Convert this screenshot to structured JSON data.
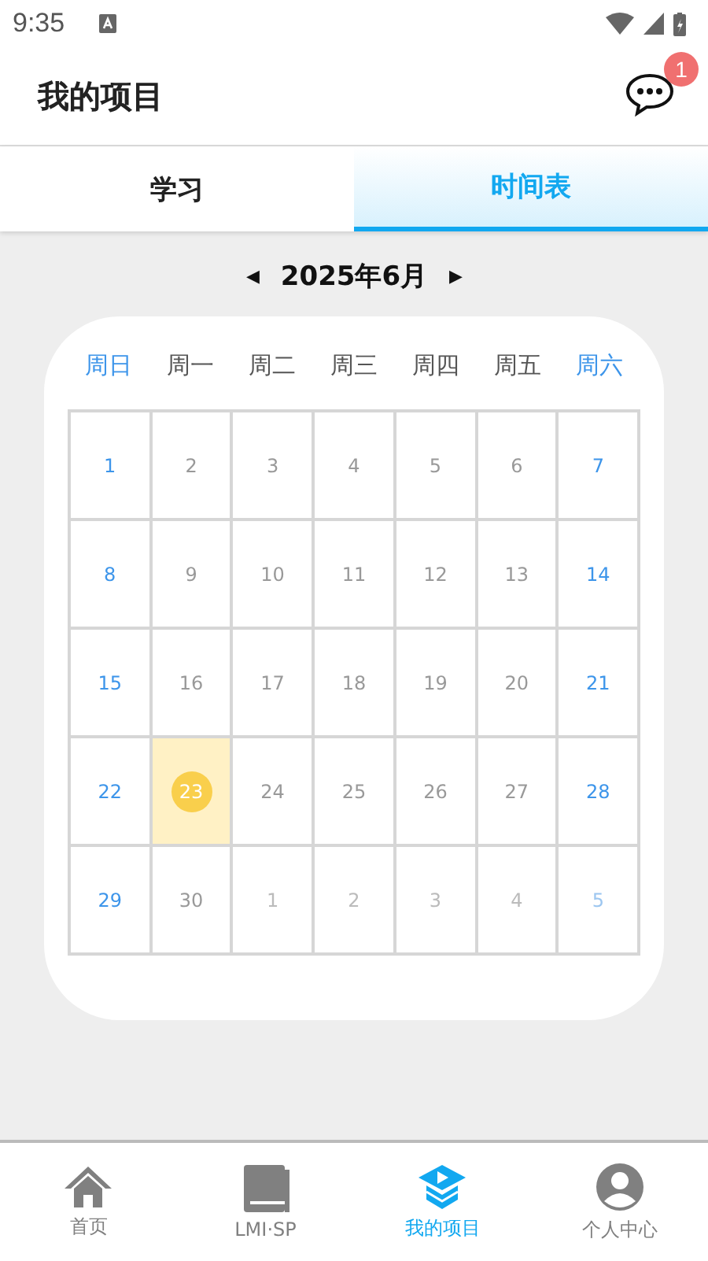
{
  "status_bar": {
    "time": "9:35"
  },
  "header": {
    "title": "我的项目",
    "badge": "1"
  },
  "tabs": [
    {
      "label": "学习",
      "selected": false
    },
    {
      "label": "时间表",
      "selected": true
    }
  ],
  "month_nav": {
    "prev": "◀",
    "month": "2025年6月",
    "next": "▶"
  },
  "weekdays": [
    {
      "label": "周日",
      "kind": "weekend"
    },
    {
      "label": "周一",
      "kind": "weekday"
    },
    {
      "label": "周二",
      "kind": "weekday"
    },
    {
      "label": "周三",
      "kind": "weekday"
    },
    {
      "label": "周四",
      "kind": "weekday"
    },
    {
      "label": "周五",
      "kind": "weekday"
    },
    {
      "label": "周六",
      "kind": "weekend"
    }
  ],
  "days": [
    {
      "label": "1",
      "kind": "weekend",
      "in_month": true,
      "selected": false
    },
    {
      "label": "2",
      "kind": "weekday",
      "in_month": true,
      "selected": false
    },
    {
      "label": "3",
      "kind": "weekday",
      "in_month": true,
      "selected": false
    },
    {
      "label": "4",
      "kind": "weekday",
      "in_month": true,
      "selected": false
    },
    {
      "label": "5",
      "kind": "weekday",
      "in_month": true,
      "selected": false
    },
    {
      "label": "6",
      "kind": "weekday",
      "in_month": true,
      "selected": false
    },
    {
      "label": "7",
      "kind": "weekend",
      "in_month": true,
      "selected": false
    },
    {
      "label": "8",
      "kind": "weekend",
      "in_month": true,
      "selected": false
    },
    {
      "label": "9",
      "kind": "weekday",
      "in_month": true,
      "selected": false
    },
    {
      "label": "10",
      "kind": "weekday",
      "in_month": true,
      "selected": false
    },
    {
      "label": "11",
      "kind": "weekday",
      "in_month": true,
      "selected": false
    },
    {
      "label": "12",
      "kind": "weekday",
      "in_month": true,
      "selected": false
    },
    {
      "label": "13",
      "kind": "weekday",
      "in_month": true,
      "selected": false
    },
    {
      "label": "14",
      "kind": "weekend",
      "in_month": true,
      "selected": false
    },
    {
      "label": "15",
      "kind": "weekend",
      "in_month": true,
      "selected": false
    },
    {
      "label": "16",
      "kind": "weekday",
      "in_month": true,
      "selected": false
    },
    {
      "label": "17",
      "kind": "weekday",
      "in_month": true,
      "selected": false
    },
    {
      "label": "18",
      "kind": "weekday",
      "in_month": true,
      "selected": false
    },
    {
      "label": "19",
      "kind": "weekday",
      "in_month": true,
      "selected": false
    },
    {
      "label": "20",
      "kind": "weekday",
      "in_month": true,
      "selected": false
    },
    {
      "label": "21",
      "kind": "weekend",
      "in_month": true,
      "selected": false
    },
    {
      "label": "22",
      "kind": "weekend",
      "in_month": true,
      "selected": false
    },
    {
      "label": "23",
      "kind": "weekday",
      "in_month": true,
      "selected": true
    },
    {
      "label": "24",
      "kind": "weekday",
      "in_month": true,
      "selected": false
    },
    {
      "label": "25",
      "kind": "weekday",
      "in_month": true,
      "selected": false
    },
    {
      "label": "26",
      "kind": "weekday",
      "in_month": true,
      "selected": false
    },
    {
      "label": "27",
      "kind": "weekday",
      "in_month": true,
      "selected": false
    },
    {
      "label": "28",
      "kind": "weekend",
      "in_month": true,
      "selected": false
    },
    {
      "label": "29",
      "kind": "weekend",
      "in_month": true,
      "selected": false
    },
    {
      "label": "30",
      "kind": "weekday",
      "in_month": true,
      "selected": false
    },
    {
      "label": "1",
      "kind": "weekday",
      "in_month": false,
      "selected": false
    },
    {
      "label": "2",
      "kind": "weekday",
      "in_month": false,
      "selected": false
    },
    {
      "label": "3",
      "kind": "weekday",
      "in_month": false,
      "selected": false
    },
    {
      "label": "4",
      "kind": "weekday",
      "in_month": false,
      "selected": false
    },
    {
      "label": "5",
      "kind": "weekend",
      "in_month": false,
      "selected": false
    }
  ],
  "bottom_nav": [
    {
      "label": "首页",
      "kind": "home",
      "selected": false
    },
    {
      "label": "LMI·SP",
      "kind": "book",
      "selected": false
    },
    {
      "label": "我的项目",
      "kind": "cap",
      "selected": true
    },
    {
      "label": "个人中心",
      "kind": "person",
      "selected": false
    }
  ]
}
